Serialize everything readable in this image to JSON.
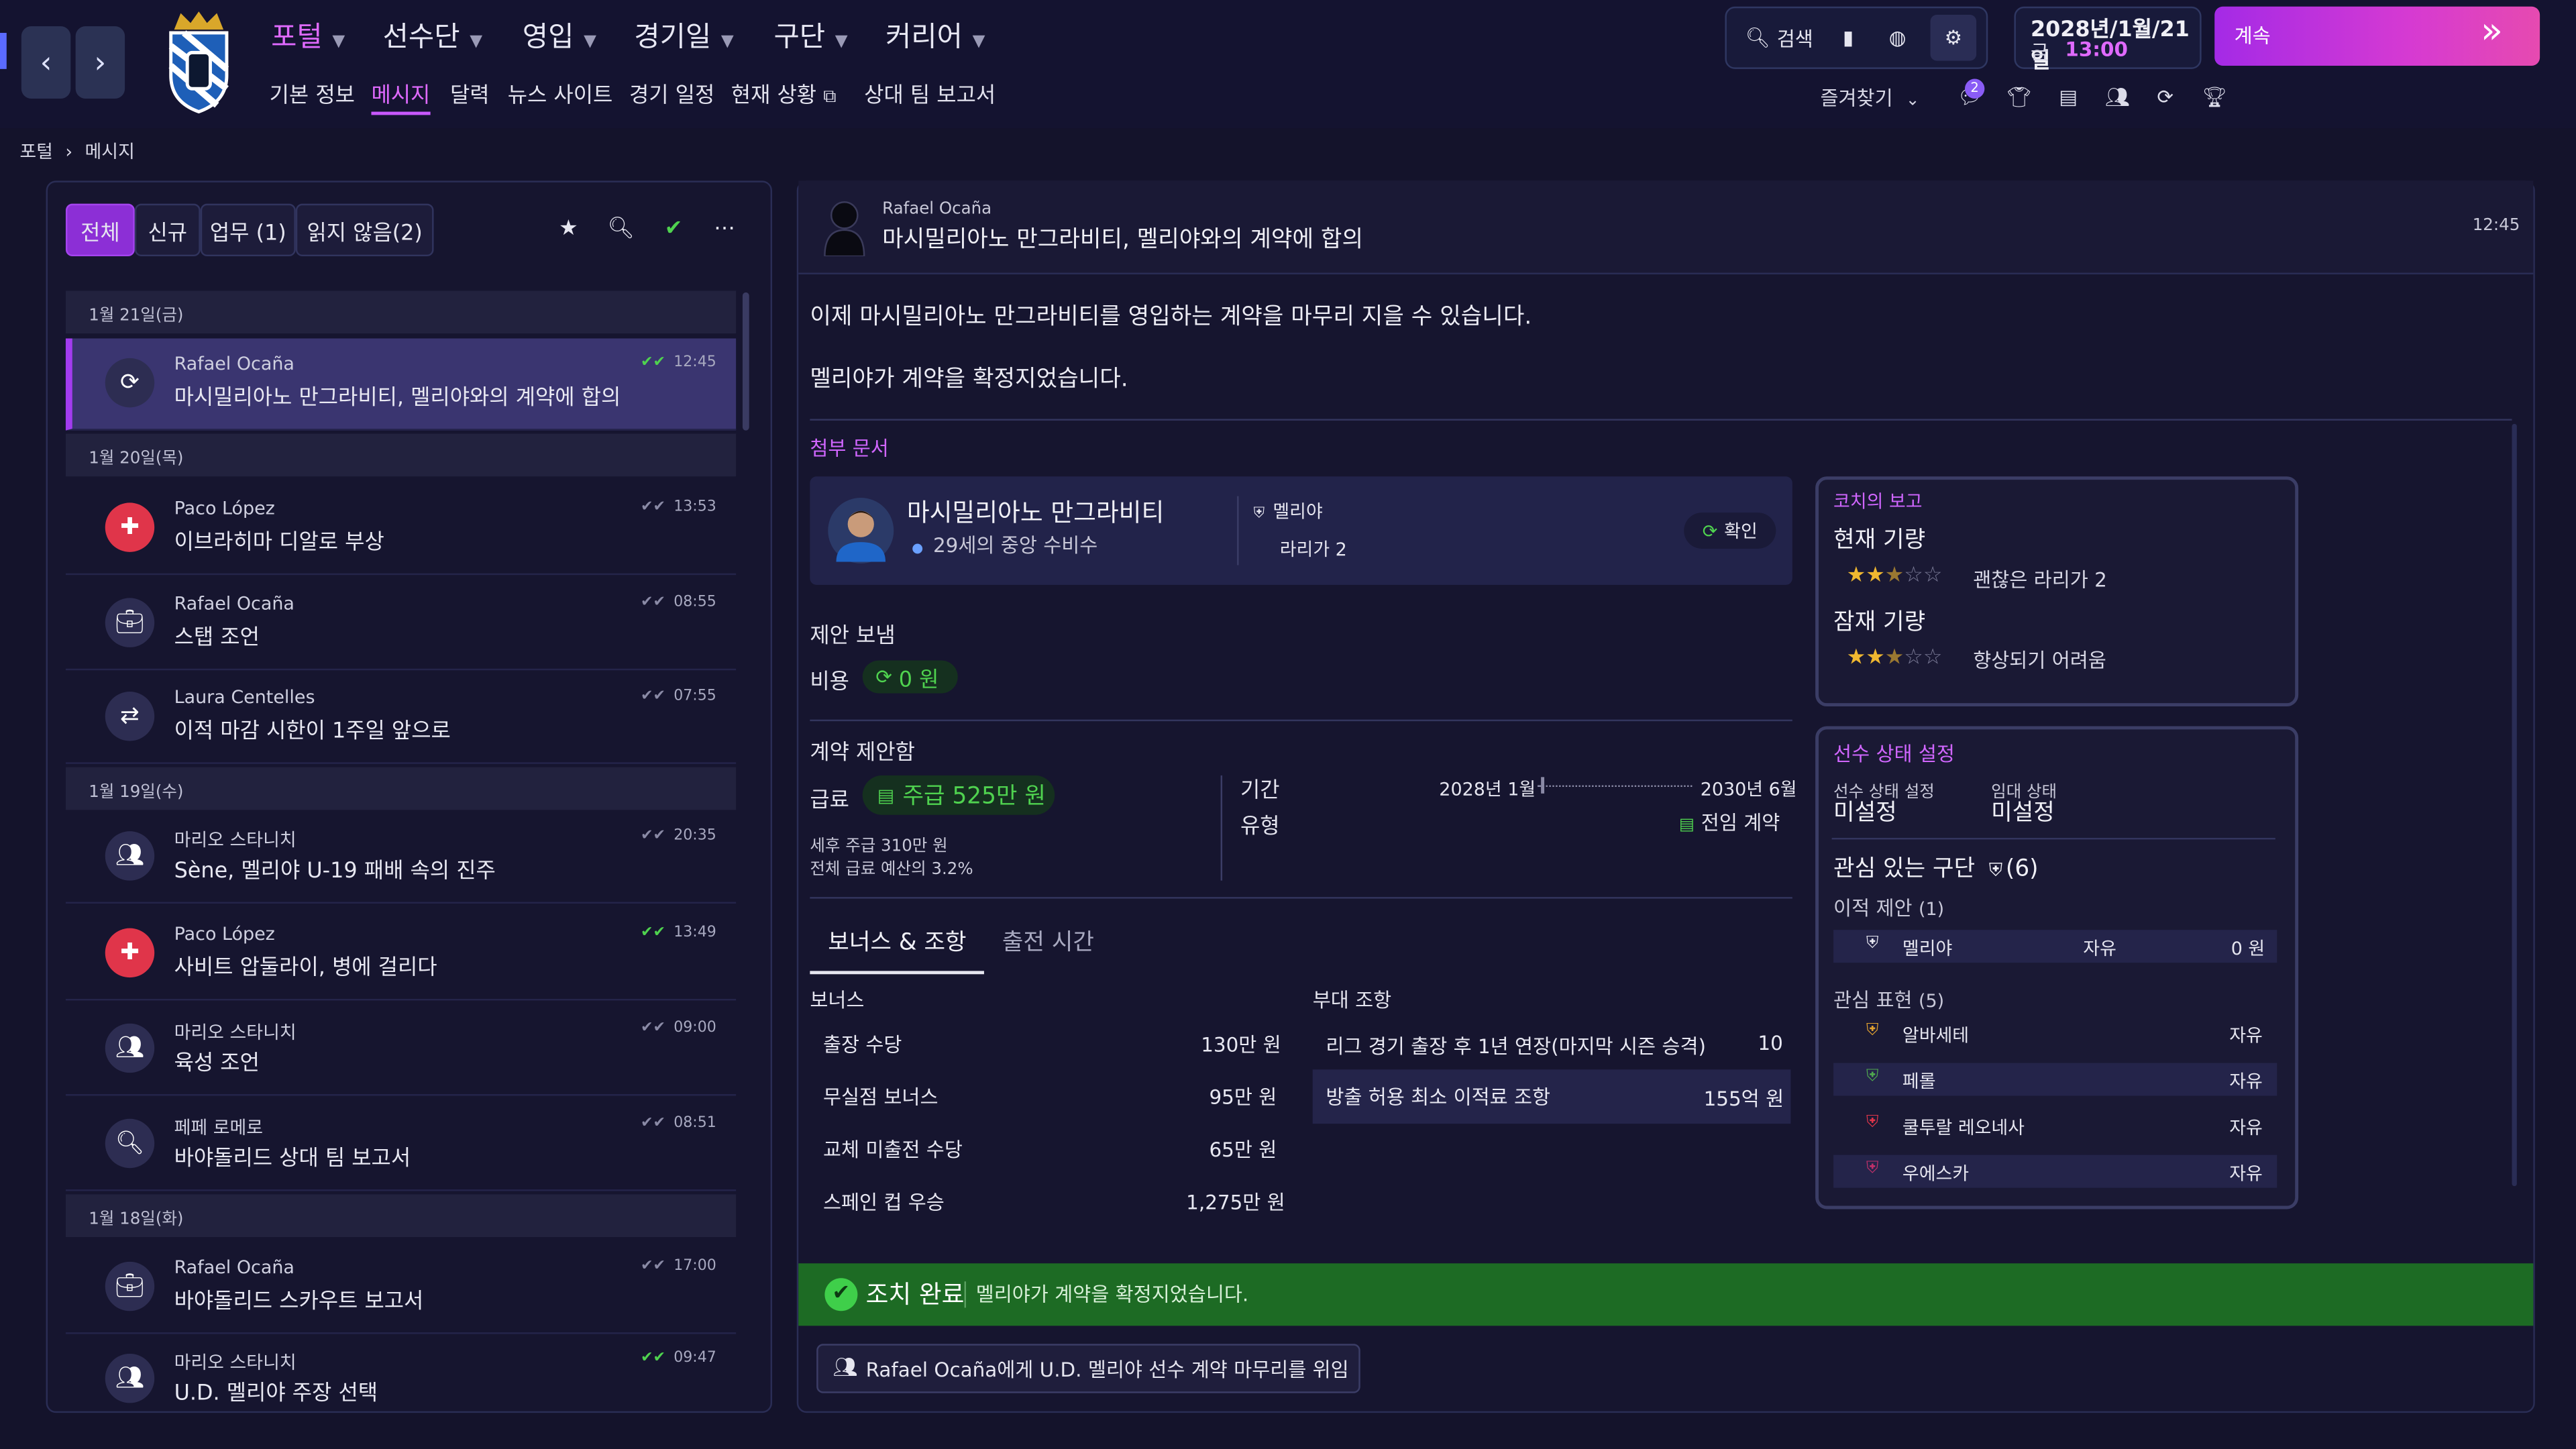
{
  "topnav": {
    "menus": [
      "포털",
      "선수단",
      "영입",
      "경기일",
      "구단",
      "커리어"
    ],
    "submenus": [
      "기본 정보",
      "메시지",
      "달력",
      "뉴스 사이트",
      "경기 일정",
      "현재 상황",
      "상대 팀 보고서"
    ],
    "search_label": "검색",
    "date_line": "2028년/1월/21일",
    "day_label": "금",
    "time": "13:00",
    "continue_label": "계속",
    "favorites_label": "즐겨찾기",
    "notif_count": "2"
  },
  "breadcrumb": {
    "root": "포털",
    "current": "메시지"
  },
  "inbox": {
    "filters": [
      "전체",
      "신규",
      "업무 (1)",
      "읽지 않음(2)"
    ],
    "date_headers": [
      "1월 21일(금)",
      "1월 20일(목)",
      "1월 19일(수)",
      "1월 18일(화)"
    ],
    "messages": [
      {
        "sender": "Rafael Ocaña",
        "subject": "마시밀리아노 만그라비티, 멜리야와의 계약에 합의",
        "time": "12:45",
        "icon": "refresh-icon"
      },
      {
        "sender": "Paco López",
        "subject": "이브라히마 디알로 부상",
        "time": "13:53",
        "icon": "medical-cross-icon"
      },
      {
        "sender": "Rafael Ocaña",
        "subject": "스탭 조언",
        "time": "08:55",
        "icon": "briefcase-icon"
      },
      {
        "sender": "Laura Centelles",
        "subject": "이적 마감 시한이 1주일 앞으로",
        "time": "07:55",
        "icon": "transfer-icon"
      },
      {
        "sender": "마리오 스타니치",
        "subject": "Sène, 멜리야 U-19 패배 속의 진주",
        "time": "20:35",
        "icon": "group-icon"
      },
      {
        "sender": "Paco López",
        "subject": "사비트 압둘라이, 병에 걸리다",
        "time": "13:49",
        "icon": "medical-cross-icon"
      },
      {
        "sender": "마리오 스타니치",
        "subject": "육성 조언",
        "time": "09:00",
        "icon": "group-icon"
      },
      {
        "sender": "페페 로메로",
        "subject": "바야돌리드 상대 팀 보고서",
        "time": "08:51",
        "icon": "magnifier-icon"
      },
      {
        "sender": "Rafael Ocaña",
        "subject": "바야돌리드 스카우트 보고서",
        "time": "17:00",
        "icon": "briefcase-icon"
      },
      {
        "sender": "마리오 스타니치",
        "subject": "U.D. 멜리야 주장 선택",
        "time": "09:47",
        "icon": "group-icon"
      }
    ]
  },
  "detail": {
    "sender": "Rafael Ocaña",
    "subject": "마시밀리아노 만그라비티, 멜리야와의 계약에 합의",
    "time": "12:45",
    "body1": "이제 마시밀리아노 만그라비티를 영입하는 계약을 마무리 지을 수 있습니다.",
    "body2": "멜리야가 계약을 확정지었습니다.",
    "attachments_label": "첨부 문서",
    "player_name": "마시밀리아노 만그라비티",
    "player_desc": "29세의 중앙 수비수",
    "club": "멜리야",
    "league": "라리가 2",
    "confirm_label": "확인",
    "offer_sent": "제안 보냄",
    "cost_label": "비용",
    "cost_value": "0 원",
    "contract_offer": "계약 제안함",
    "wage_label": "급료",
    "wage_value": "주급 525만 원",
    "after_tax": "세후 주급 310만 원",
    "wage_budget": "전체 급료 예산의 3.2%",
    "period_label": "기간",
    "period_start": "2028년 1월",
    "period_end": "2030년 6월",
    "type_label": "유형",
    "type_value": "전임 계약",
    "tabs": [
      "보너스 & 조항",
      "출전 시간"
    ],
    "bonus_label": "보너스",
    "bonuses": [
      {
        "name": "출장 수당",
        "value": "130만 원"
      },
      {
        "name": "무실점 보너스",
        "value": "95만 원"
      },
      {
        "name": "교체 미출전 수당",
        "value": "65만 원"
      },
      {
        "name": "스페인 컵 우승",
        "value": "1,275만 원"
      }
    ],
    "clauses_label": "부대 조항",
    "clauses": [
      {
        "name": "리그 경기 출장 후 1년 연장(마지막 시즌 승격)",
        "value": "10"
      },
      {
        "name": "방출 허용 최소 이적료 조항",
        "value": "155억 원"
      }
    ],
    "action_done": "조치 완료",
    "action_text": "멜리야가 계약을 확정지었습니다.",
    "delegate_label": "Rafael Ocaña에게 U.D. 멜리야 선수 계약 마무리를 위임"
  },
  "coach_report": {
    "title": "코치의 보고",
    "current_label": "현재 기량",
    "current_stars": 2.5,
    "current_desc": "괜찮은 라리가 2",
    "potential_label": "잠재 기량",
    "potential_stars": 2.5,
    "potential_desc": "향상되기 어려움"
  },
  "player_status": {
    "title": "선수 상태 설정",
    "status_label": "선수 상태 설정",
    "status_value": "미설정",
    "loan_label": "임대 상태",
    "loan_value": "미설정",
    "interested_label": "관심 있는 구단",
    "interested_count": "(6)",
    "offers_label": "이적 제안",
    "offers_count": "(1)",
    "offers": [
      {
        "club": "멜리야",
        "status": "자유",
        "fee": "0 원"
      }
    ],
    "interest_label": "관심 표현",
    "interest_count": "(5)",
    "interest": [
      {
        "club": "알바세테",
        "status": "자유"
      },
      {
        "club": "페롤",
        "status": "자유"
      },
      {
        "club": "쿨투랄 레오네사",
        "status": "자유"
      },
      {
        "club": "우에스카",
        "status": "자유"
      }
    ]
  }
}
